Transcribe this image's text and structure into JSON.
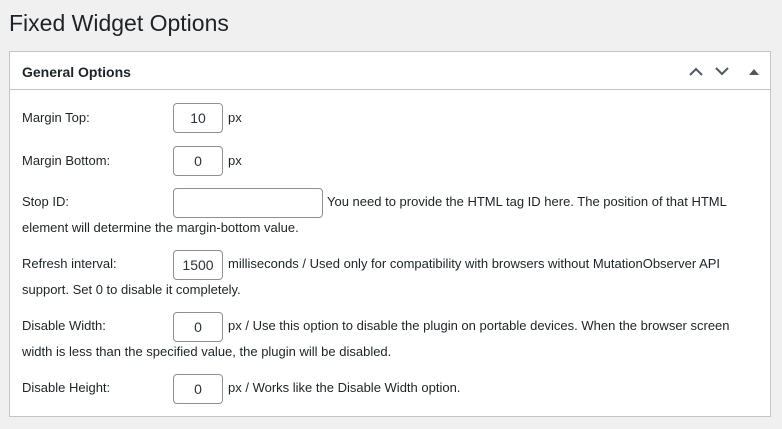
{
  "page": {
    "title": "Fixed Widget Options"
  },
  "box": {
    "title": "General Options",
    "controls": [
      "move-up",
      "move-down",
      "toggle-panel"
    ]
  },
  "fields": {
    "margin_top": {
      "label": "Margin Top:",
      "value": "10",
      "suffix": "px"
    },
    "margin_bottom": {
      "label": "Margin Bottom:",
      "value": "0",
      "suffix": "px"
    },
    "stop_id": {
      "label": "Stop ID:",
      "value": "",
      "desc_line1": "You need to provide the HTML tag ID here. The position of that HTML",
      "desc_line2": "element will determine the margin-bottom value."
    },
    "refresh_interval": {
      "label": "Refresh interval:",
      "value": "1500",
      "desc_line1": "milliseconds / Used only for compatibility with browsers without MutationObserver API",
      "desc_line2": "support. Set 0 to disable it completely."
    },
    "disable_width": {
      "label": "Disable Width:",
      "value": "0",
      "desc_line1": "px / Use this option to disable the plugin on portable devices. When the browser screen",
      "desc_line2": "width is less than the specified value, the plugin will be disabled."
    },
    "disable_height": {
      "label": "Disable Height:",
      "value": "0",
      "desc_line1": "px / Works like the Disable Width option."
    }
  }
}
